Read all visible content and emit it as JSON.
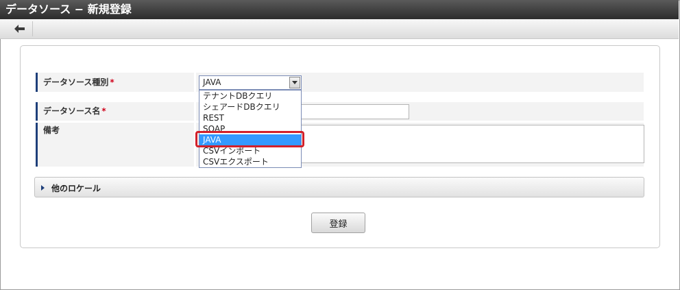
{
  "window": {
    "title": "データソース − 新規登録"
  },
  "toolbar": {
    "back_icon": "arrow-left-icon"
  },
  "form": {
    "type_label": "データソース種別",
    "name_label": "データソース名",
    "note_label": "備考",
    "required_mark": "*",
    "type_select": {
      "selected": "JAVA",
      "options": [
        "テナントDBクエリ",
        "シェアードDBクエリ",
        "REST",
        "SOAP",
        "JAVA",
        "CSVインポート",
        "CSVエクスポート"
      ],
      "highlighted_option": "JAVA"
    },
    "name_value": "",
    "note_value": "",
    "other_locale_label": "他のロケール",
    "submit_label": "登録"
  },
  "colors": {
    "title_bar": "#3a3a3a",
    "label_accent": "#1e3f7a",
    "required": "#d0021b",
    "selection": "#3399ff",
    "highlight_box": "#d2202a"
  }
}
